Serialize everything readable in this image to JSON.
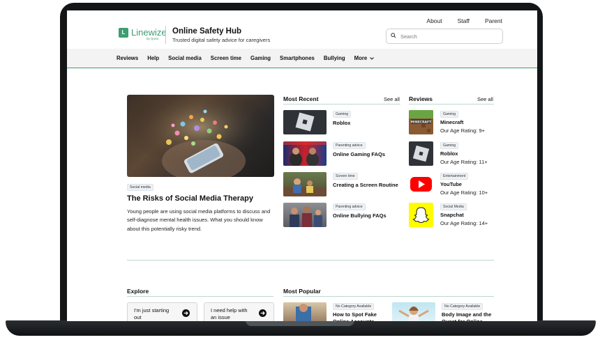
{
  "header": {
    "top_links": [
      "About",
      "Staff",
      "Parent"
    ],
    "logo_text": "Linewize",
    "logo_sub": "by Qoria",
    "site_title": "Online Safety Hub",
    "site_subtitle": "Trusted digital safety advice for caregivers",
    "search_placeholder": "Search"
  },
  "nav": {
    "items": [
      "Reviews",
      "Help",
      "Social media",
      "Screen time",
      "Gaming",
      "Smartphones",
      "Bullying"
    ],
    "more_label": "More"
  },
  "feature": {
    "tag": "Social media",
    "title": "The Risks of Social Media Therapy",
    "description": "Young people are using social media platforms to discuss and self-diagnose mental health issues. What you should know about this potentially risky trend."
  },
  "most_recent": {
    "heading": "Most Recent",
    "see_all": "See all",
    "items": [
      {
        "tag": "Gaming",
        "title": "Roblox",
        "image": "roblox-logo"
      },
      {
        "tag": "Parenting advice",
        "title": "Online Gaming FAQs",
        "image": "gamers-photo"
      },
      {
        "tag": "Screen time",
        "title": "Creating a Screen Routine",
        "image": "family-couch-photo"
      },
      {
        "tag": "Parenting advice",
        "title": "Online Bullying FAQs",
        "image": "teens-photo"
      }
    ]
  },
  "reviews": {
    "heading": "Reviews",
    "see_all": "See all",
    "items": [
      {
        "tag": "Gaming",
        "title": "Minecraft",
        "rating": "Our Age Rating: 9+",
        "image": "minecraft-logo"
      },
      {
        "tag": "Gaming",
        "title": "Roblox",
        "rating": "Our Age Rating: 11+",
        "image": "roblox-logo"
      },
      {
        "tag": "Entertainment",
        "title": "YouTube",
        "rating": "Our Age Rating: 10+",
        "image": "youtube-logo"
      },
      {
        "tag": "Social Media",
        "title": "Snapchat",
        "rating": "Our Age Rating: 14+",
        "image": "snapchat-logo"
      }
    ]
  },
  "explore": {
    "heading": "Explore",
    "buttons": [
      "I'm just starting out",
      "I need help with an issue"
    ]
  },
  "most_popular": {
    "heading": "Most Popular",
    "items": [
      {
        "tag": "No Category Available",
        "title": "How to Spot Fake Online Accounts",
        "image": "person-photo"
      },
      {
        "tag": "No Category Available",
        "title": "Body Image and the Quest for Online",
        "image": "girl-photo"
      }
    ]
  },
  "colors": {
    "brand_green": "#3e9d73",
    "youtube_red": "#ff0000",
    "snapchat_yellow": "#fffc00"
  }
}
